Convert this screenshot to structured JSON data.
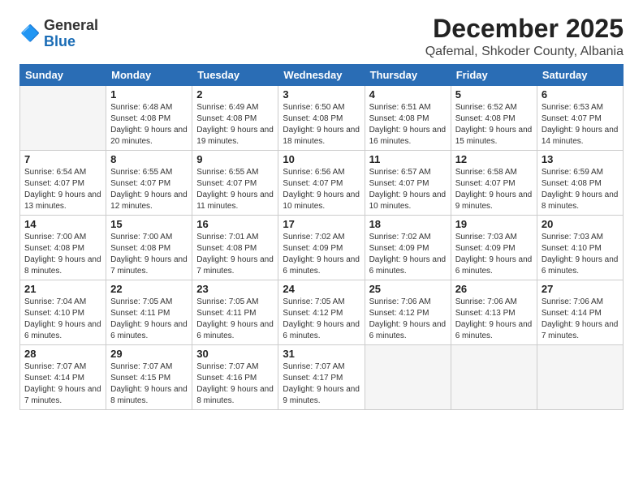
{
  "logo": {
    "general": "General",
    "blue": "Blue"
  },
  "header": {
    "month": "December 2025",
    "location": "Qafemal, Shkoder County, Albania"
  },
  "weekdays": [
    "Sunday",
    "Monday",
    "Tuesday",
    "Wednesday",
    "Thursday",
    "Friday",
    "Saturday"
  ],
  "weeks": [
    [
      {
        "day": null
      },
      {
        "day": "1",
        "sunrise": "6:48 AM",
        "sunset": "4:08 PM",
        "daylight": "9 hours and 20 minutes."
      },
      {
        "day": "2",
        "sunrise": "6:49 AM",
        "sunset": "4:08 PM",
        "daylight": "9 hours and 19 minutes."
      },
      {
        "day": "3",
        "sunrise": "6:50 AM",
        "sunset": "4:08 PM",
        "daylight": "9 hours and 18 minutes."
      },
      {
        "day": "4",
        "sunrise": "6:51 AM",
        "sunset": "4:08 PM",
        "daylight": "9 hours and 16 minutes."
      },
      {
        "day": "5",
        "sunrise": "6:52 AM",
        "sunset": "4:08 PM",
        "daylight": "9 hours and 15 minutes."
      },
      {
        "day": "6",
        "sunrise": "6:53 AM",
        "sunset": "4:07 PM",
        "daylight": "9 hours and 14 minutes."
      }
    ],
    [
      {
        "day": "7",
        "sunrise": "6:54 AM",
        "sunset": "4:07 PM",
        "daylight": "9 hours and 13 minutes."
      },
      {
        "day": "8",
        "sunrise": "6:55 AM",
        "sunset": "4:07 PM",
        "daylight": "9 hours and 12 minutes."
      },
      {
        "day": "9",
        "sunrise": "6:55 AM",
        "sunset": "4:07 PM",
        "daylight": "9 hours and 11 minutes."
      },
      {
        "day": "10",
        "sunrise": "6:56 AM",
        "sunset": "4:07 PM",
        "daylight": "9 hours and 10 minutes."
      },
      {
        "day": "11",
        "sunrise": "6:57 AM",
        "sunset": "4:07 PM",
        "daylight": "9 hours and 10 minutes."
      },
      {
        "day": "12",
        "sunrise": "6:58 AM",
        "sunset": "4:07 PM",
        "daylight": "9 hours and 9 minutes."
      },
      {
        "day": "13",
        "sunrise": "6:59 AM",
        "sunset": "4:08 PM",
        "daylight": "9 hours and 8 minutes."
      }
    ],
    [
      {
        "day": "14",
        "sunrise": "7:00 AM",
        "sunset": "4:08 PM",
        "daylight": "9 hours and 8 minutes."
      },
      {
        "day": "15",
        "sunrise": "7:00 AM",
        "sunset": "4:08 PM",
        "daylight": "9 hours and 7 minutes."
      },
      {
        "day": "16",
        "sunrise": "7:01 AM",
        "sunset": "4:08 PM",
        "daylight": "9 hours and 7 minutes."
      },
      {
        "day": "17",
        "sunrise": "7:02 AM",
        "sunset": "4:09 PM",
        "daylight": "9 hours and 6 minutes."
      },
      {
        "day": "18",
        "sunrise": "7:02 AM",
        "sunset": "4:09 PM",
        "daylight": "9 hours and 6 minutes."
      },
      {
        "day": "19",
        "sunrise": "7:03 AM",
        "sunset": "4:09 PM",
        "daylight": "9 hours and 6 minutes."
      },
      {
        "day": "20",
        "sunrise": "7:03 AM",
        "sunset": "4:10 PM",
        "daylight": "9 hours and 6 minutes."
      }
    ],
    [
      {
        "day": "21",
        "sunrise": "7:04 AM",
        "sunset": "4:10 PM",
        "daylight": "9 hours and 6 minutes."
      },
      {
        "day": "22",
        "sunrise": "7:05 AM",
        "sunset": "4:11 PM",
        "daylight": "9 hours and 6 minutes."
      },
      {
        "day": "23",
        "sunrise": "7:05 AM",
        "sunset": "4:11 PM",
        "daylight": "9 hours and 6 minutes."
      },
      {
        "day": "24",
        "sunrise": "7:05 AM",
        "sunset": "4:12 PM",
        "daylight": "9 hours and 6 minutes."
      },
      {
        "day": "25",
        "sunrise": "7:06 AM",
        "sunset": "4:12 PM",
        "daylight": "9 hours and 6 minutes."
      },
      {
        "day": "26",
        "sunrise": "7:06 AM",
        "sunset": "4:13 PM",
        "daylight": "9 hours and 6 minutes."
      },
      {
        "day": "27",
        "sunrise": "7:06 AM",
        "sunset": "4:14 PM",
        "daylight": "9 hours and 7 minutes."
      }
    ],
    [
      {
        "day": "28",
        "sunrise": "7:07 AM",
        "sunset": "4:14 PM",
        "daylight": "9 hours and 7 minutes."
      },
      {
        "day": "29",
        "sunrise": "7:07 AM",
        "sunset": "4:15 PM",
        "daylight": "9 hours and 8 minutes."
      },
      {
        "day": "30",
        "sunrise": "7:07 AM",
        "sunset": "4:16 PM",
        "daylight": "9 hours and 8 minutes."
      },
      {
        "day": "31",
        "sunrise": "7:07 AM",
        "sunset": "4:17 PM",
        "daylight": "9 hours and 9 minutes."
      },
      {
        "day": null
      },
      {
        "day": null
      },
      {
        "day": null
      }
    ]
  ]
}
